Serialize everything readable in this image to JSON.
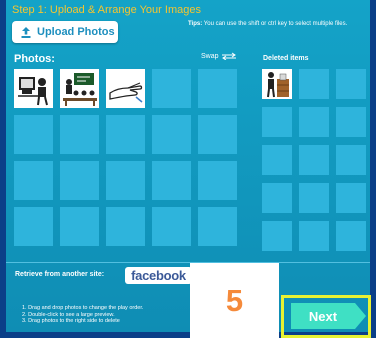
{
  "header": {
    "step_title": "Step 1: Upload & Arrange Your Images",
    "upload_label": "Upload Photos",
    "tips_bold": "Tips:",
    "tips_text": " You can use the shift or ctrl key to select multiple files."
  },
  "photos": {
    "label": "Photos:",
    "swap_label": "Swap"
  },
  "deleted": {
    "label": "Deleted items"
  },
  "retrieve": {
    "label": "Retrieve from another site:",
    "facebook_label": "facebook"
  },
  "instructions": [
    "1. Drag and drop photos to change the play order.",
    "2. Double-click to see a large preview.",
    "3. Drag photos to the right side to delete"
  ],
  "badge": {
    "value": "5"
  },
  "next": {
    "label": "Next"
  },
  "colors": {
    "background": "#1193b9",
    "tile": "#2eb4dc",
    "title_yellow": "#f6c52f",
    "badge_orange": "#f58a3b",
    "next_green": "#3fe0c4",
    "highlight_yellow": "#e7f233"
  }
}
